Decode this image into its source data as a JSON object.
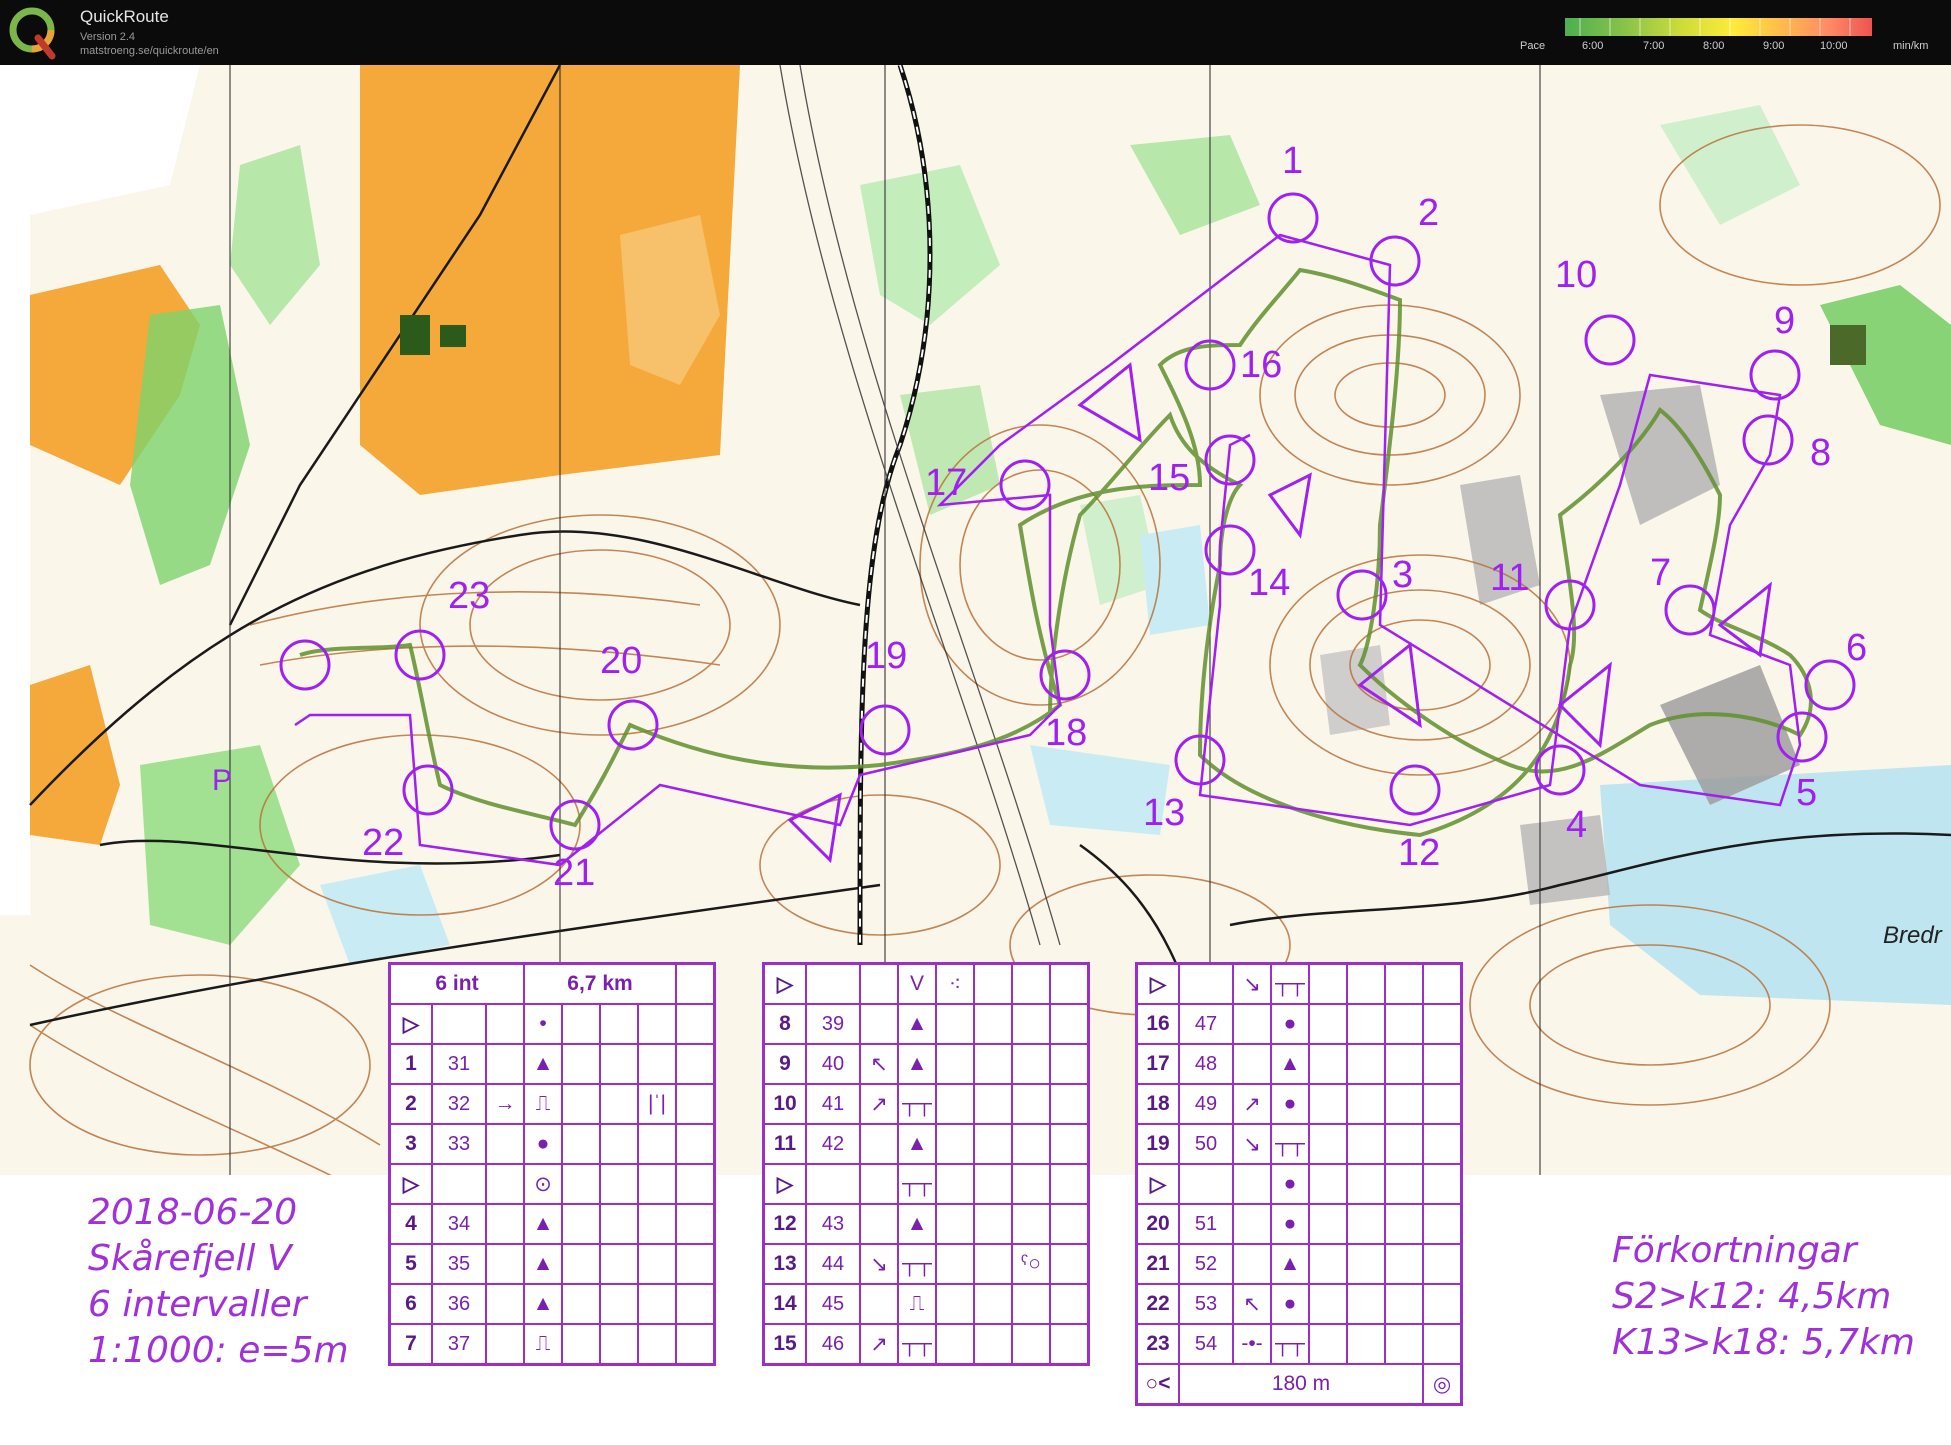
{
  "app": {
    "name": "QuickRoute",
    "version": "Version 2.4",
    "url": "matstroeng.se/quickroute/en"
  },
  "pace_scale": {
    "label": "Pace",
    "ticks": [
      "6:00",
      "7:00",
      "8:00",
      "9:00",
      "10:00"
    ],
    "unit": "min/km",
    "colors": [
      "#4caf50",
      "#8bc34a",
      "#cddc39",
      "#ffeb3b",
      "#ffb74d",
      "#ff8a65",
      "#ef5350"
    ]
  },
  "map": {
    "place_label": "Bredr",
    "parking_label": "P",
    "controls": [
      "1",
      "2",
      "3",
      "4",
      "5",
      "6",
      "7",
      "8",
      "9",
      "10",
      "11",
      "12",
      "13",
      "14",
      "15",
      "16",
      "17",
      "18",
      "19",
      "20",
      "21",
      "22",
      "23"
    ],
    "course_color": "#a020f0",
    "route_color": "#5a8a2a"
  },
  "description_sheet": {
    "header_left": "6 int",
    "header_right": "6,7 km",
    "col1": [
      {
        "num": "",
        "code": "",
        "sym": "start"
      },
      {
        "num": "1",
        "code": "31",
        "sym": "▲"
      },
      {
        "num": "2",
        "code": "32",
        "sym": "⎍"
      },
      {
        "num": "3",
        "code": "33",
        "sym": "●"
      },
      {
        "num": "",
        "code": "",
        "sym": "start"
      },
      {
        "num": "4",
        "code": "34",
        "sym": "▲"
      },
      {
        "num": "5",
        "code": "35",
        "sym": "▲"
      },
      {
        "num": "6",
        "code": "36",
        "sym": "▲"
      },
      {
        "num": "7",
        "code": "37",
        "sym": "⎍"
      }
    ],
    "col2": [
      {
        "num": "",
        "code": "",
        "sym": "start"
      },
      {
        "num": "8",
        "code": "39",
        "sym": "▲"
      },
      {
        "num": "9",
        "code": "40",
        "sym": "▲"
      },
      {
        "num": "10",
        "code": "41",
        "sym": "┬┬"
      },
      {
        "num": "11",
        "code": "42",
        "sym": "▲"
      },
      {
        "num": "",
        "code": "",
        "sym": "start"
      },
      {
        "num": "12",
        "code": "43",
        "sym": "▲"
      },
      {
        "num": "13",
        "code": "44",
        "sym": "┬┬"
      },
      {
        "num": "14",
        "code": "45",
        "sym": "⎍"
      },
      {
        "num": "15",
        "code": "46",
        "sym": "┬┬"
      }
    ],
    "col3": [
      {
        "num": "",
        "code": "",
        "sym": "start"
      },
      {
        "num": "16",
        "code": "47",
        "sym": "●"
      },
      {
        "num": "17",
        "code": "48",
        "sym": "▲"
      },
      {
        "num": "18",
        "code": "49",
        "sym": "●"
      },
      {
        "num": "19",
        "code": "50",
        "sym": "┬┬"
      },
      {
        "num": "",
        "code": "",
        "sym": "start"
      },
      {
        "num": "20",
        "code": "51",
        "sym": "●"
      },
      {
        "num": "21",
        "code": "52",
        "sym": "▲"
      },
      {
        "num": "22",
        "code": "53",
        "sym": "●"
      },
      {
        "num": "23",
        "code": "54",
        "sym": "┬┬"
      }
    ],
    "finish_distance": "180 m"
  },
  "annotation_left": {
    "line1": "2018-06-20",
    "line2": "Skårefjell V",
    "line3": "6 intervaller",
    "line4": "1:1000: e=5m"
  },
  "annotation_right": {
    "line1": "Förkortningar",
    "line2": "S2>k12: 4,5km",
    "line3": "K13>k18: 5,7km"
  }
}
